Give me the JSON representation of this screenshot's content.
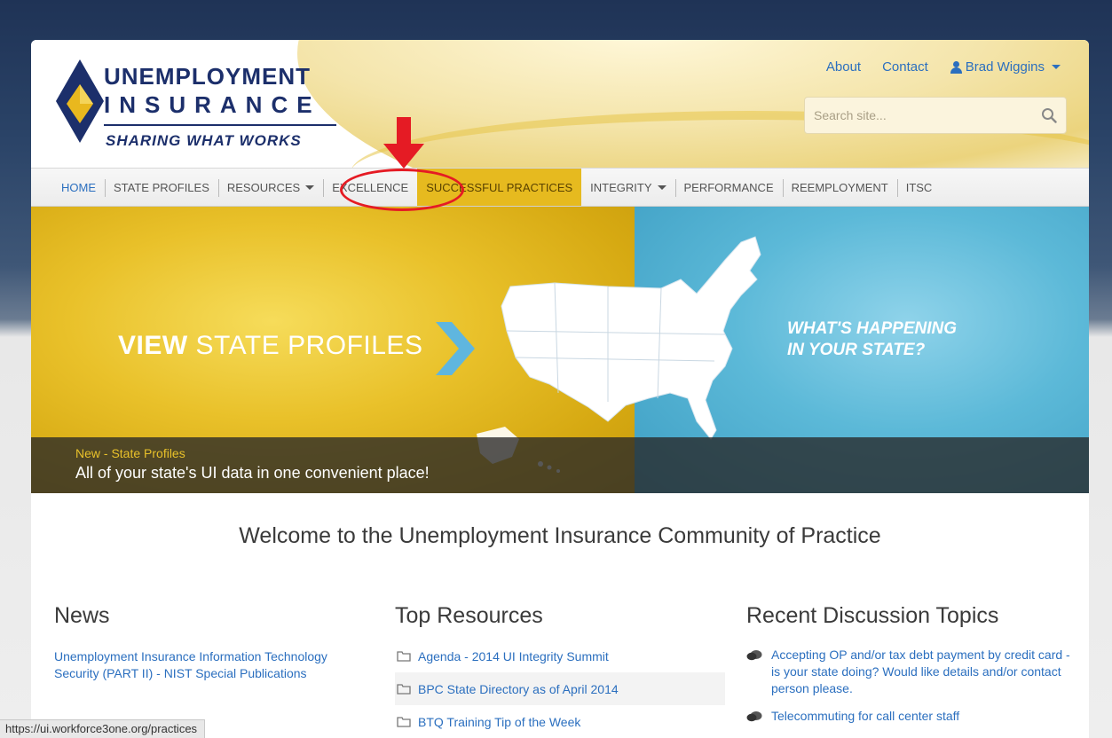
{
  "logo": {
    "line1": "UNEMPLOYMENT",
    "line2": "INSURANCE",
    "tagline": "SHARING WHAT WORKS"
  },
  "top_links": {
    "about": "About",
    "contact": "Contact",
    "user": "Brad Wiggins"
  },
  "search": {
    "placeholder": "Search site..."
  },
  "nav": {
    "items": [
      {
        "label": "HOME"
      },
      {
        "label": "STATE PROFILES"
      },
      {
        "label": "RESOURCES"
      },
      {
        "label": "EXCELLENCE"
      },
      {
        "label": "SUCCESSFUL PRACTICES"
      },
      {
        "label": "INTEGRITY"
      },
      {
        "label": "PERFORMANCE"
      },
      {
        "label": "REEMPLOYMENT"
      },
      {
        "label": "ITSC"
      }
    ]
  },
  "hero": {
    "view_bold": "VIEW",
    "view_rest": "STATE PROFILES",
    "whats_line1": "WHAT'S HAPPENING",
    "whats_line2": "IN YOUR STATE?",
    "kicker": "New - State Profiles",
    "caption": "All of your state's UI data in one convenient place!"
  },
  "welcome": "Welcome to the Unemployment Insurance Community of Practice",
  "news": {
    "title": "News",
    "items": [
      "Unemployment Insurance Information Technology Security (PART II) - NIST Special Publications"
    ]
  },
  "resources": {
    "title": "Top Resources",
    "items": [
      "Agenda - 2014 UI Integrity Summit",
      "BPC State Directory as of April 2014",
      "BTQ Training Tip of the Week"
    ]
  },
  "discussion": {
    "title": "Recent Discussion Topics",
    "items": [
      "Accepting OP and/or tax debt payment by credit card - is your state doing? Would like details and/or contact person please.",
      "Telecommuting for call center staff"
    ]
  },
  "status_bar": "https://ui.workforce3one.org/practices",
  "colors": {
    "accent_gold": "#e6ba1f",
    "link_blue": "#2b6fbf",
    "annotation_red": "#e51b24",
    "logo_navy": "#1c2f6b"
  }
}
